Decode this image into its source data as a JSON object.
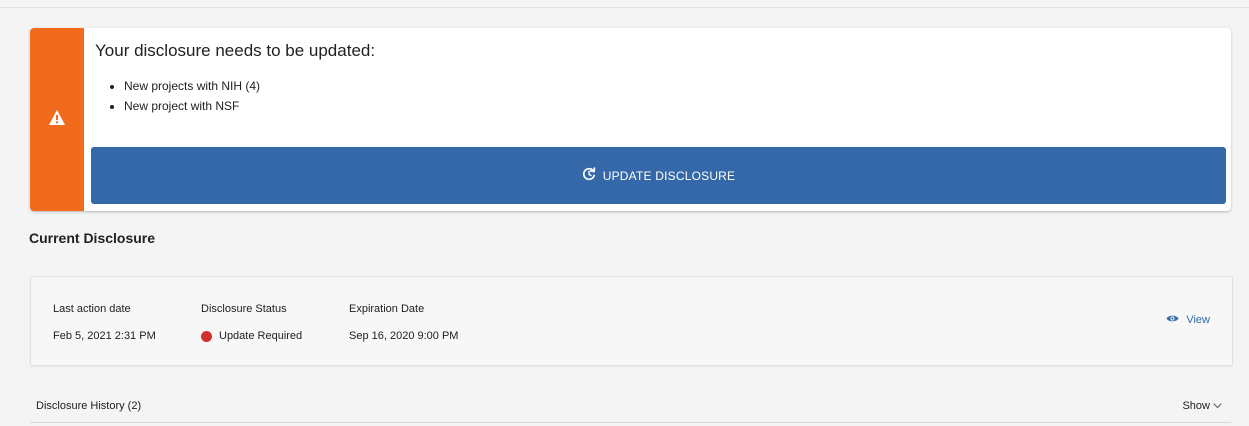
{
  "alert": {
    "title": "Your disclosure needs to be updated:",
    "items": [
      {
        "text": "New projects with NIH (4)"
      },
      {
        "text": "New project with NSF"
      }
    ],
    "update_button_label": "UPDATE DISCLOSURE",
    "stripe_color": "#f26b1d",
    "icon": "warning-icon"
  },
  "current_disclosure": {
    "title": "Current Disclosure",
    "last_action": {
      "label": "Last action date",
      "value": "Feb 5, 2021 2:31 PM"
    },
    "status": {
      "label": "Disclosure Status",
      "value": "Update Required",
      "color": "#d32f2f"
    },
    "expiration": {
      "label": "Expiration Date",
      "value": "Sep 16, 2020 9:00 PM"
    },
    "view_label": "View",
    "view_icon": "eye-icon"
  },
  "history": {
    "label": "Disclosure History (2)",
    "toggle_label": "Show",
    "toggle_icon": "chevron-down-icon"
  },
  "colors": {
    "accent": "#3468a9",
    "background": "#f4f4f4"
  }
}
